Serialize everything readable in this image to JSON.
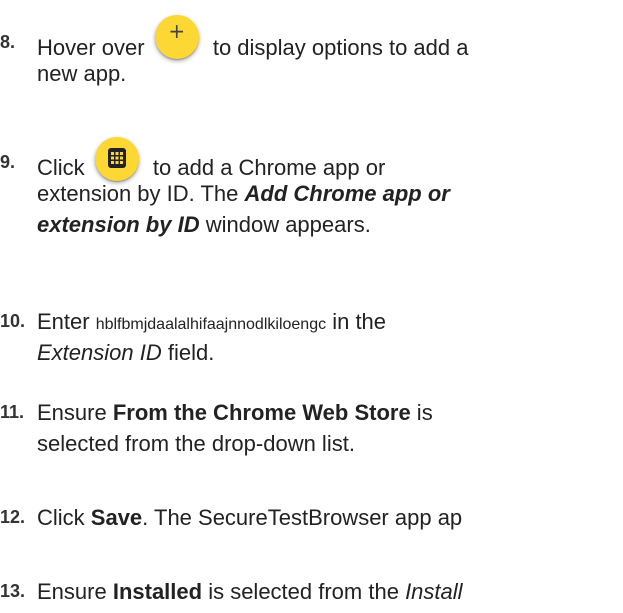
{
  "steps": [
    {
      "number": "8.",
      "line1_before": "Hover over",
      "line1_after": "to display options to add a",
      "line2": "new app.",
      "icon": "plus-icon",
      "icon_glyph": "+"
    },
    {
      "number": "9.",
      "line1_before": "Click",
      "line1_after": "to add a Chrome app or",
      "line2_before": "extension by ID. The ",
      "line2_emph": "Add Chrome app or",
      "line3_emph": "extension by ID",
      "line3_after": " window appears.",
      "icon": "app-grid-icon"
    },
    {
      "number": "10.",
      "line1_before": "Enter ",
      "line1_code": "hblfbmjdaalalhifaajnnodlkiloengc",
      "line1_after": " in the",
      "line2_emph": "Extension ID",
      "line2_after": " field."
    },
    {
      "number": "11.",
      "line1_before": "Ensure ",
      "line1_bold": "From the Chrome Web Store",
      "line1_after": " is",
      "line2": "selected from the drop-down list."
    },
    {
      "number": "12.",
      "line1_before": "Click ",
      "line1_bold": "Save",
      "line1_after": ". The SecureTestBrowser app ap"
    },
    {
      "number": "13.",
      "line1_before": "Ensure ",
      "line1_bold": "Installed",
      "line1_after": " is selected from the ",
      "line1_italic": "Install"
    }
  ],
  "colors": {
    "button_yellow": "#fdd835",
    "text": "#222222"
  }
}
